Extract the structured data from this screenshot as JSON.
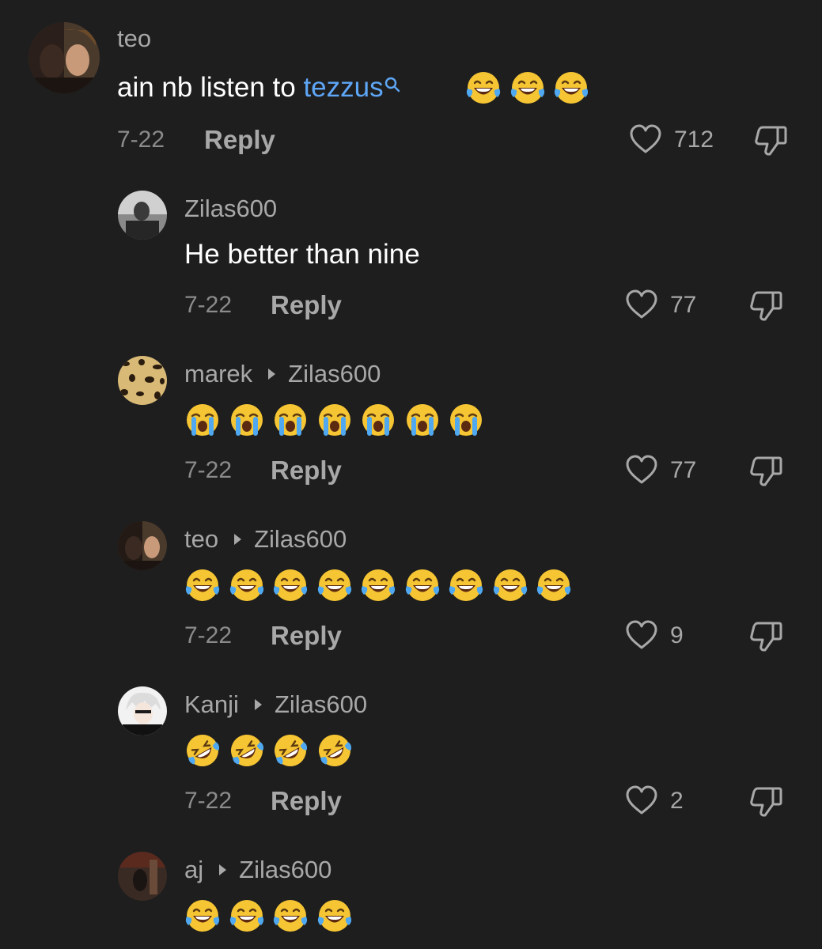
{
  "comments": [
    {
      "author": "teo",
      "reply_to": "",
      "text_prefix": "ain nb listen to ",
      "mention": "tezzus",
      "emojis": [
        "joy",
        "joy",
        "joy"
      ],
      "date": "7-22",
      "reply_label": "Reply",
      "likes": "712"
    },
    {
      "author": "Zilas600",
      "reply_to": "",
      "text": "He better than nine",
      "date": "7-22",
      "reply_label": "Reply",
      "likes": "77"
    },
    {
      "author": "marek",
      "reply_to": "Zilas600",
      "emojis": [
        "sob",
        "sob",
        "sob",
        "sob",
        "sob",
        "sob",
        "sob"
      ],
      "date": "7-22",
      "reply_label": "Reply",
      "likes": "77"
    },
    {
      "author": "teo",
      "reply_to": "Zilas600",
      "emojis": [
        "joy",
        "joy",
        "joy",
        "joy",
        "joy",
        "joy",
        "joy",
        "joy",
        "joy"
      ],
      "date": "7-22",
      "reply_label": "Reply",
      "likes": "9"
    },
    {
      "author": "Kanji",
      "reply_to": "Zilas600",
      "emojis": [
        "rofl",
        "rofl",
        "rofl",
        "rofl"
      ],
      "date": "7-22",
      "reply_label": "Reply",
      "likes": "2"
    },
    {
      "author": "aj",
      "reply_to": "Zilas600",
      "emojis": [
        "joy",
        "joy",
        "joy",
        "joy"
      ]
    }
  ],
  "icons": {
    "like": "heart-outline-icon",
    "dislike": "thumbs-down-outline-icon",
    "mention_search": "search-icon",
    "reply_arrow": "triangle-right-icon"
  },
  "colors": {
    "background": "#1e1e1e",
    "mention": "#5ea6f6",
    "muted_text": "#a8a8a8"
  }
}
